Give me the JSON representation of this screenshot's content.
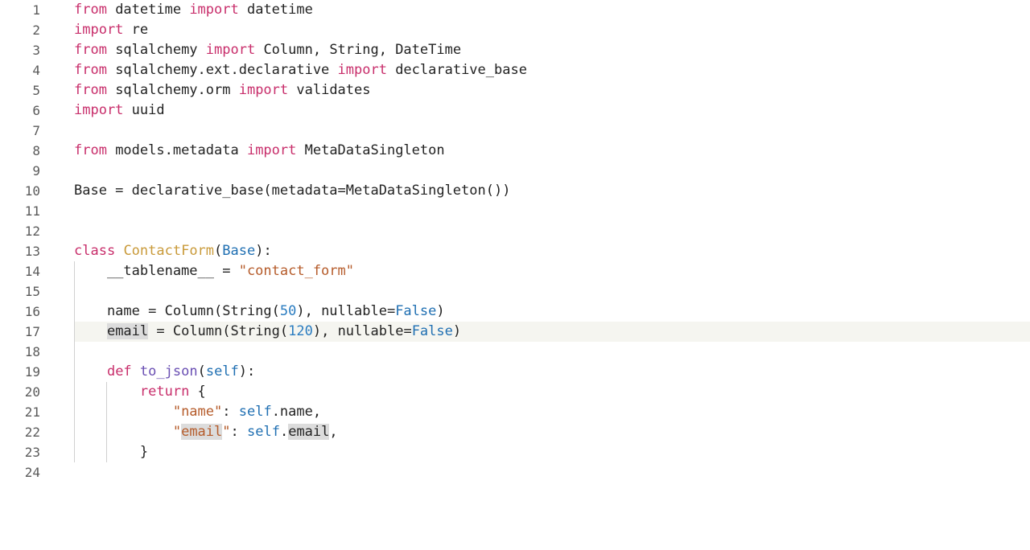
{
  "editor": {
    "active_line": 17,
    "lines": [
      {
        "n": 1,
        "indent": 0,
        "tokens": [
          [
            "kw",
            "from"
          ],
          [
            "plain",
            " datetime "
          ],
          [
            "kw",
            "import"
          ],
          [
            "plain",
            " datetime"
          ]
        ]
      },
      {
        "n": 2,
        "indent": 0,
        "tokens": [
          [
            "kw",
            "import"
          ],
          [
            "plain",
            " re"
          ]
        ]
      },
      {
        "n": 3,
        "indent": 0,
        "tokens": [
          [
            "kw",
            "from"
          ],
          [
            "plain",
            " sqlalchemy "
          ],
          [
            "kw",
            "import"
          ],
          [
            "plain",
            " Column, String, DateTime"
          ]
        ]
      },
      {
        "n": 4,
        "indent": 0,
        "tokens": [
          [
            "kw",
            "from"
          ],
          [
            "plain",
            " sqlalchemy.ext.declarative "
          ],
          [
            "kw",
            "import"
          ],
          [
            "plain",
            " declarative_base"
          ]
        ]
      },
      {
        "n": 5,
        "indent": 0,
        "tokens": [
          [
            "kw",
            "from"
          ],
          [
            "plain",
            " sqlalchemy.orm "
          ],
          [
            "kw",
            "import"
          ],
          [
            "plain",
            " validates"
          ]
        ]
      },
      {
        "n": 6,
        "indent": 0,
        "tokens": [
          [
            "kw",
            "import"
          ],
          [
            "plain",
            " uuid"
          ]
        ]
      },
      {
        "n": 7,
        "indent": 0,
        "tokens": []
      },
      {
        "n": 8,
        "indent": 0,
        "tokens": [
          [
            "kw",
            "from"
          ],
          [
            "plain",
            " models.metadata "
          ],
          [
            "kw",
            "import"
          ],
          [
            "plain",
            " MetaDataSingleton"
          ]
        ]
      },
      {
        "n": 9,
        "indent": 0,
        "tokens": []
      },
      {
        "n": 10,
        "indent": 0,
        "tokens": [
          [
            "plain",
            "Base = declarative_base(metadata=MetaDataSingleton())"
          ]
        ]
      },
      {
        "n": 11,
        "indent": 0,
        "tokens": []
      },
      {
        "n": 12,
        "indent": 0,
        "tokens": []
      },
      {
        "n": 13,
        "indent": 0,
        "tokens": [
          [
            "kw",
            "class"
          ],
          [
            "plain",
            " "
          ],
          [
            "cls",
            "ContactForm"
          ],
          [
            "plain",
            "("
          ],
          [
            "self",
            "Base"
          ],
          [
            "plain",
            "):"
          ]
        ]
      },
      {
        "n": 14,
        "indent": 1,
        "tokens": [
          [
            "plain",
            "    __tablename__ = "
          ],
          [
            "str",
            "\"contact_form\""
          ]
        ]
      },
      {
        "n": 15,
        "indent": 1,
        "tokens": []
      },
      {
        "n": 16,
        "indent": 1,
        "tokens": [
          [
            "plain",
            "    name = Column(String("
          ],
          [
            "num",
            "50"
          ],
          [
            "plain",
            "), nullable="
          ],
          [
            "const",
            "False"
          ],
          [
            "plain",
            ")"
          ]
        ]
      },
      {
        "n": 17,
        "indent": 1,
        "tokens": [
          [
            "plain",
            "    "
          ],
          [
            "hl",
            "email"
          ],
          [
            "plain",
            " = Column(String("
          ],
          [
            "num",
            "120"
          ],
          [
            "plain",
            "), nullable="
          ],
          [
            "const",
            "False"
          ],
          [
            "plain",
            ")"
          ]
        ]
      },
      {
        "n": 18,
        "indent": 1,
        "tokens": []
      },
      {
        "n": 19,
        "indent": 1,
        "tokens": [
          [
            "plain",
            "    "
          ],
          [
            "kw",
            "def"
          ],
          [
            "plain",
            " "
          ],
          [
            "fn",
            "to_json"
          ],
          [
            "plain",
            "("
          ],
          [
            "self",
            "self"
          ],
          [
            "plain",
            "):"
          ]
        ]
      },
      {
        "n": 20,
        "indent": 2,
        "tokens": [
          [
            "plain",
            "        "
          ],
          [
            "kw",
            "return"
          ],
          [
            "plain",
            " {"
          ]
        ]
      },
      {
        "n": 21,
        "indent": 2,
        "tokens": [
          [
            "plain",
            "            "
          ],
          [
            "str",
            "\"name\""
          ],
          [
            "plain",
            ": "
          ],
          [
            "self",
            "self"
          ],
          [
            "plain",
            ".name,"
          ]
        ]
      },
      {
        "n": 22,
        "indent": 2,
        "tokens": [
          [
            "plain",
            "            "
          ],
          [
            "str",
            "\""
          ],
          [
            "strhl",
            "email"
          ],
          [
            "str",
            "\""
          ],
          [
            "plain",
            ": "
          ],
          [
            "self",
            "self"
          ],
          [
            "plain",
            "."
          ],
          [
            "hl",
            "email"
          ],
          [
            "plain",
            ","
          ]
        ]
      },
      {
        "n": 23,
        "indent": 2,
        "tokens": [
          [
            "plain",
            "        }"
          ]
        ]
      },
      {
        "n": 24,
        "indent": 0,
        "tokens": []
      }
    ]
  }
}
